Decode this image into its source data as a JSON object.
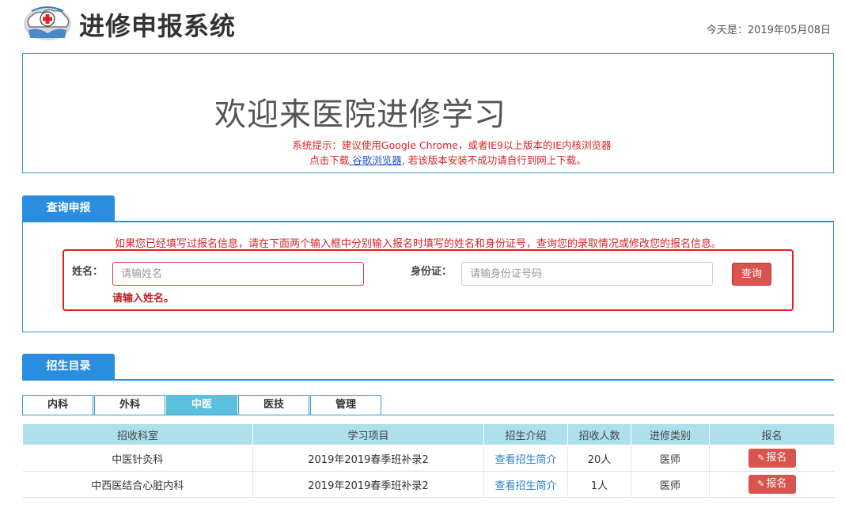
{
  "header": {
    "app_title": "进修申报系统",
    "date_text": "今天是：2019年05月08日"
  },
  "welcome": {
    "title": "欢迎来医院进修学习",
    "hint_line1": "系统提示：建议使用Google Chrome，或者IE9以上版本的IE内核浏览器",
    "hint_line2_prefix": "点击下载",
    "hint_link": " 谷歌浏览器",
    "hint_line2_suffix": ", 若该版本安装不成功请自行到网上下载。"
  },
  "query": {
    "tab_label": "查询申报",
    "notice": "如果您已经填写过报名信息，请在下面两个输入框中分别输入报名时填写的姓名和身份证号，查询您的录取情况或修改您的报名信息。",
    "name_label": "姓名：",
    "name_placeholder": "请输姓名",
    "name_error": "请输入姓名。",
    "id_label": "身份证：",
    "id_placeholder": "请输身份证号码",
    "query_button": "查询"
  },
  "catalog": {
    "tab_label": "招生目录",
    "dept_tabs": [
      "内科",
      "外科",
      "中医",
      "医技",
      "管理"
    ],
    "active_tab": "中医",
    "columns": [
      "招收科室",
      "学习项目",
      "招生介绍",
      "招收人数",
      "进修类别",
      "报名"
    ],
    "rows": [
      {
        "dept": "中医针灸科",
        "project": "2019年2019春季班补录2",
        "intro": "查看招生简介",
        "count": "20人",
        "category": "医师",
        "apply": "报名"
      },
      {
        "dept": "中西医结合心脏内科",
        "project": "2019年2019春季班补录2",
        "intro": "查看招生简介",
        "count": "1人",
        "category": "医师",
        "apply": "报名"
      }
    ]
  },
  "colors": {
    "accent": "#2a8de0",
    "border": "#3a9bc0",
    "danger": "#d9534f",
    "table_header": "#aee0ec",
    "active_tab": "#5bc0de"
  }
}
